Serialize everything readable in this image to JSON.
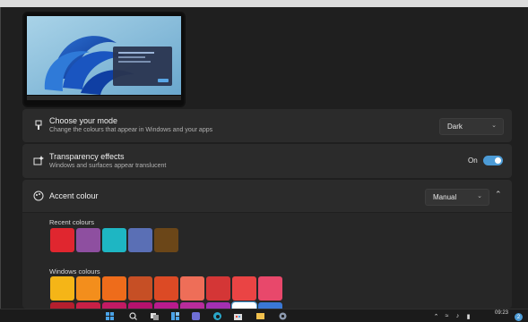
{
  "theme_preview": {
    "alt": "theme preview"
  },
  "mode": {
    "title": "Choose your mode",
    "subtitle": "Change the colours that appear in Windows and your apps",
    "value": "Dark",
    "icon": "brush-icon"
  },
  "transparency": {
    "title": "Transparency effects",
    "subtitle": "Windows and surfaces appear translucent",
    "state_label": "On",
    "on": true,
    "icon": "sparkle-icon"
  },
  "accent": {
    "title": "Accent colour",
    "value": "Manual",
    "icon": "palette-icon",
    "recent_label": "Recent colours",
    "recent_colors": [
      "#e0262f",
      "#8e4fa0",
      "#1eb6c3",
      "#5a6fb5",
      "#6b4618"
    ],
    "windows_label": "Windows colours",
    "windows_colors_row1": [
      "#f5b517",
      "#f38e1c",
      "#ee6c1b",
      "#c64f25",
      "#dc4a25",
      "#ee6e58",
      "#d43636",
      "#ea4444",
      "#e8486b"
    ],
    "windows_colors_row2": [
      "#b41f2e",
      "#c82046",
      "#c21a63",
      "#b5126d",
      "#b91b8d",
      "#b82c9b",
      "#a330b2",
      "#ffffff",
      "#3a78d6"
    ]
  },
  "taskbar": {
    "time": "09:23",
    "notification_count": "2",
    "icons": [
      "start-icon",
      "search-icon",
      "task-view-icon",
      "widgets-icon",
      "chat-icon",
      "edge-icon",
      "store-icon",
      "explorer-icon",
      "settings-icon",
      "misc-icon"
    ],
    "tray": [
      "chevron-up-icon",
      "wifi-icon",
      "volume-icon",
      "battery-icon"
    ]
  },
  "colors": {
    "accent": "#4c9bd6",
    "card": "#2b2b2b",
    "background": "#1f1f1f"
  }
}
